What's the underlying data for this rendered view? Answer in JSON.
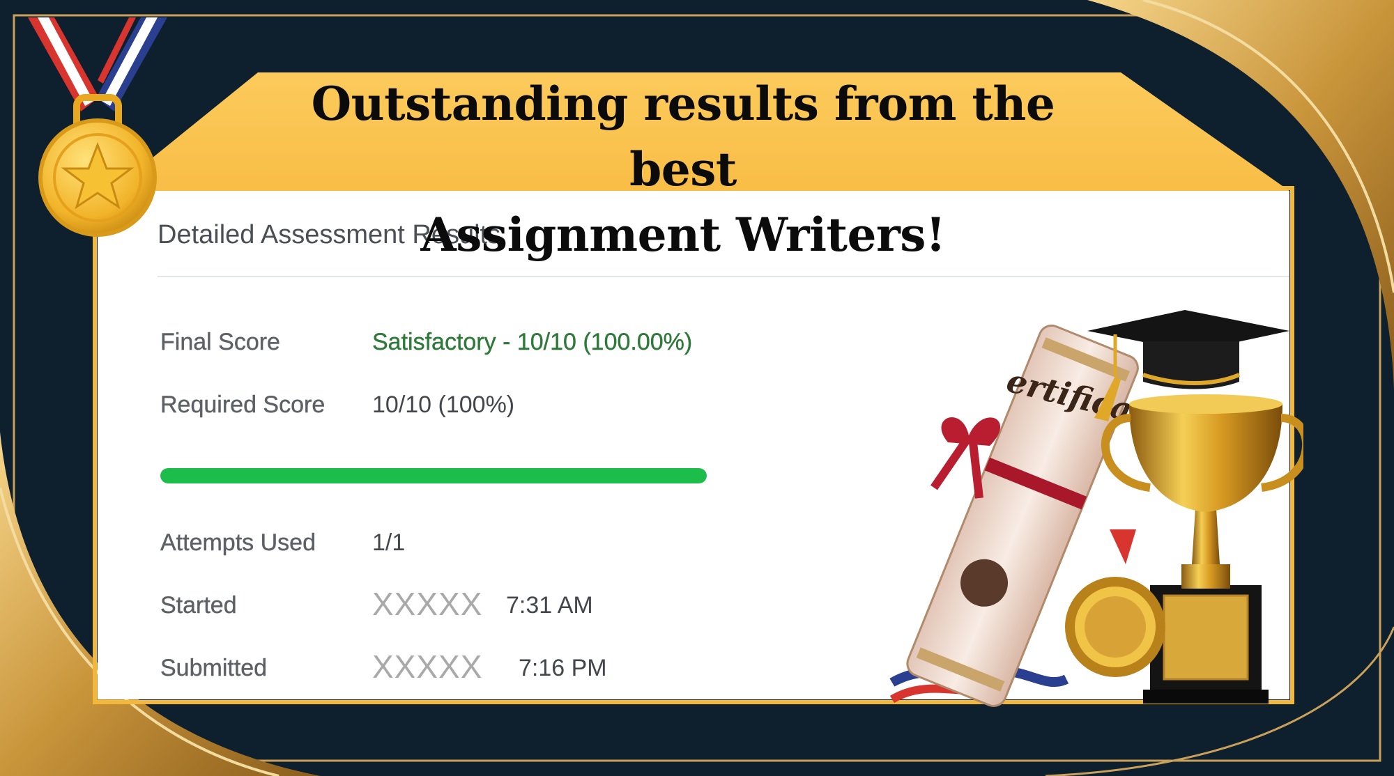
{
  "banner": {
    "line1": "Outstanding results from the best",
    "line2": "Assignment Writers!"
  },
  "results": {
    "title": "Detailed Assessment Results",
    "final_score_label": "Final Score",
    "final_score_value": "Satisfactory - 10/10 (100.00%)",
    "required_score_label": "Required Score",
    "required_score_value": "10/10 (100%)",
    "progress_percent": 100,
    "attempts_label": "Attempts Used",
    "attempts_value": "1/1",
    "started_label": "Started",
    "started_date": "XXXXX",
    "started_time": "7:31 AM",
    "submitted_label": "Submitted",
    "submitted_date": "XXXXX",
    "submitted_time": "7:16 PM"
  },
  "decor": {
    "certificate_text": "ertifica",
    "icons": [
      "medal-icon",
      "graduation-cap-icon",
      "trophy-icon",
      "certificate-scroll-icon",
      "gold-medal-icon"
    ]
  },
  "colors": {
    "background": "#0e1f2e",
    "gold": "#f9c04a",
    "progress": "#1cbd4b",
    "score_green": "#2f7a3a"
  }
}
